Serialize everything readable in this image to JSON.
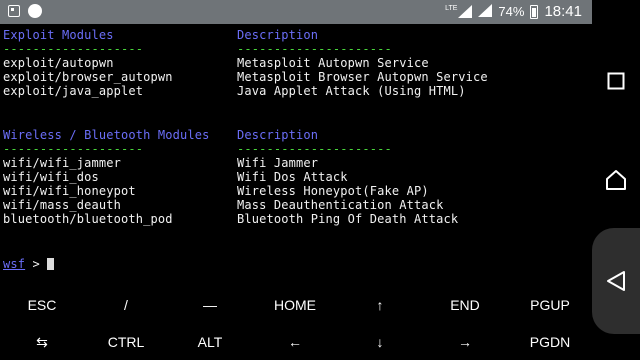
{
  "status_bar": {
    "network": "LTE",
    "battery": "74%",
    "time": "18:41"
  },
  "terminal": {
    "exploit_header": {
      "left": "Exploit Modules",
      "right": "Description"
    },
    "exploit_rule": {
      "left": "-------------------",
      "right": "---------------------"
    },
    "exploit_rows": [
      {
        "module": "exploit/autopwn",
        "desc": "Metasploit Autopwn Service"
      },
      {
        "module": "exploit/browser_autopwn",
        "desc": "Metasploit Browser Autopwn Service"
      },
      {
        "module": "exploit/java_applet",
        "desc": "Java Applet Attack (Using HTML)"
      }
    ],
    "wireless_header": {
      "left": "Wireless / Bluetooth Modules",
      "right": "Description"
    },
    "wireless_rule": {
      "left": "-------------------",
      "right": "---------------------"
    },
    "wireless_rows": [
      {
        "module": "wifi/wifi_jammer",
        "desc": "Wifi Jammer"
      },
      {
        "module": "wifi/wifi_dos",
        "desc": "Wifi Dos Attack"
      },
      {
        "module": "wifi/wifi_honeypot",
        "desc": "Wireless Honeypot(Fake AP)"
      },
      {
        "module": "wifi/mass_deauth",
        "desc": "Mass Deauthentication Attack"
      },
      {
        "module": "bluetooth/bluetooth_pod",
        "desc": "Bluetooth Ping Of Death Attack"
      }
    ],
    "prompt": {
      "name": "wsf",
      "symbol": " > "
    }
  },
  "extra_keys": {
    "row1": [
      "ESC",
      "/",
      "—",
      "HOME",
      "↑",
      "END",
      "PGUP"
    ],
    "row2": [
      "⇆",
      "CTRL",
      "ALT",
      "←",
      "↓",
      "→",
      "PGDN"
    ]
  },
  "nav_bar": {
    "icons": [
      "recents-icon",
      "home-icon",
      "back-icon"
    ]
  }
}
